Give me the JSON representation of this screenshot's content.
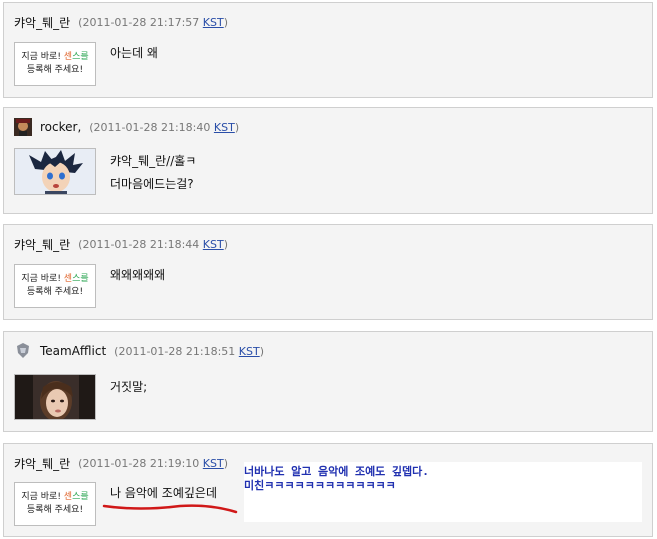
{
  "comments": [
    {
      "author": "캬악_퉤_란",
      "timestamp": "(2011-01-28 21:17:57",
      "tz": "KST",
      "close": ")",
      "lines": [
        "아는데 왜"
      ],
      "avatar": "signature",
      "sig": {
        "row1": [
          "지금 ",
          "바로! ",
          "센",
          "스를"
        ],
        "row2": "등록해 주세요!"
      }
    },
    {
      "author": "rocker,",
      "timestamp": "(2011-01-28 21:18:40",
      "tz": "KST",
      "close": ")",
      "lines": [
        "캬악_퉤_란//홀ㅋ",
        "더마음에드는걸?"
      ],
      "avatar": "anime-boy"
    },
    {
      "author": "캬악_퉤_란",
      "timestamp": "(2011-01-28 21:18:44",
      "tz": "KST",
      "close": ")",
      "lines": [
        "왜왜왜왜왜"
      ],
      "avatar": "signature",
      "sig": {
        "row1": [
          "지금 ",
          "바로! ",
          "센",
          "스를"
        ],
        "row2": "등록해 주세요!"
      }
    },
    {
      "author": "TeamAfflict",
      "timestamp": "(2011-01-28 21:18:51",
      "tz": "KST",
      "close": ")",
      "lines": [
        "거짓말;"
      ],
      "avatar": "photo"
    },
    {
      "author": "캬악_퉤_란",
      "timestamp": "(2011-01-28 21:19:10",
      "tz": "KST",
      "close": ")",
      "lines": [
        "나 음악에 조예깊은데"
      ],
      "avatar": "signature",
      "sig": {
        "row1": [
          "지금 ",
          "바로! ",
          "센",
          "스를"
        ],
        "row2": "등록해 주세요!"
      }
    }
  ],
  "overlay": {
    "line1": "너바나도 알고 음악에 조예도 깊뎁다.",
    "line2": "미친ㅋㅋㅋㅋㅋㅋㅋㅋㅋㅋㅋㅋㅋ"
  },
  "colors": {
    "panel": "#f4f4f4",
    "border": "#cfcfcf",
    "link": "#2a4ea8",
    "overlay_text": "#2030b0",
    "underline": "#d01818"
  }
}
